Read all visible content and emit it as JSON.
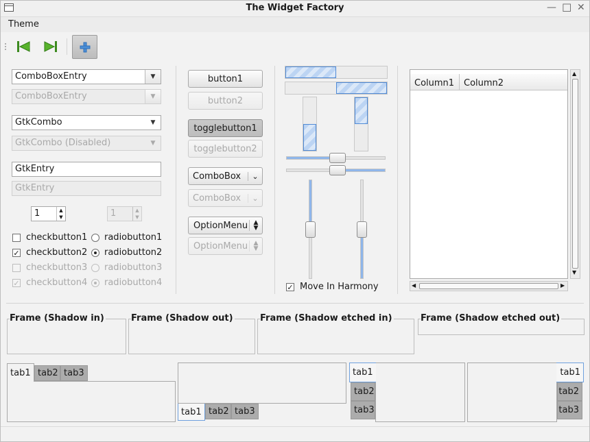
{
  "window": {
    "title": "The Widget Factory",
    "controls": {
      "minimize": "—",
      "maximize": "☐",
      "close": "✕"
    }
  },
  "menubar": {
    "items": [
      "Theme"
    ]
  },
  "toolbar": {
    "back_icon": "go-first-icon",
    "forward_icon": "go-last-icon",
    "add_icon": "add-icon"
  },
  "col1": {
    "combo_entry": "ComboBoxEntry",
    "combo_entry_disabled": "ComboBoxEntry",
    "gtkcombo": "GtkCombo",
    "gtkcombo_disabled": "GtkCombo (Disabled)",
    "entry": "GtkEntry",
    "entry_disabled": "GtkEntry",
    "spin": "1",
    "spin_disabled": "1",
    "checks": [
      {
        "label": "checkbutton1",
        "checked": false,
        "disabled": false
      },
      {
        "label": "checkbutton2",
        "checked": true,
        "disabled": false
      },
      {
        "label": "checkbutton3",
        "checked": false,
        "disabled": true
      },
      {
        "label": "checkbutton4",
        "checked": true,
        "disabled": true
      }
    ],
    "radios": [
      {
        "label": "radiobutton1",
        "selected": false,
        "disabled": false
      },
      {
        "label": "radiobutton2",
        "selected": true,
        "disabled": false
      },
      {
        "label": "radiobutton3",
        "selected": false,
        "disabled": true
      },
      {
        "label": "radiobutton4",
        "selected": true,
        "disabled": true
      }
    ]
  },
  "col2": {
    "button1": "button1",
    "button2": "button2",
    "toggle1": "togglebutton1",
    "toggle2": "togglebutton2",
    "combobox": "ComboBox",
    "combobox_disabled": "ComboBox",
    "optionmenu": "OptionMenu",
    "optionmenu_disabled": "OptionMenu"
  },
  "col3": {
    "progress_h1": 0.5,
    "progress_h2": 0.5,
    "progress_v1": 0.5,
    "progress_v2": 0.5,
    "hscale1": 0.5,
    "hscale2": 0.5,
    "vscale1": 0.5,
    "vscale2": 0.5,
    "move_in_harmony": "Move In Harmony",
    "move_in_harmony_checked": true
  },
  "treeview": {
    "columns": [
      "Column1",
      "Column2"
    ]
  },
  "frames": [
    "Frame (Shadow in)",
    "Frame (Shadow out)",
    "Frame (Shadow etched in)",
    "Frame (Shadow etched out)"
  ],
  "notebooks": {
    "tabs": [
      "tab1",
      "tab2",
      "tab3"
    ]
  },
  "colors": {
    "accent": "#4f8ad6",
    "slider_fill": "#8fb6ea"
  }
}
